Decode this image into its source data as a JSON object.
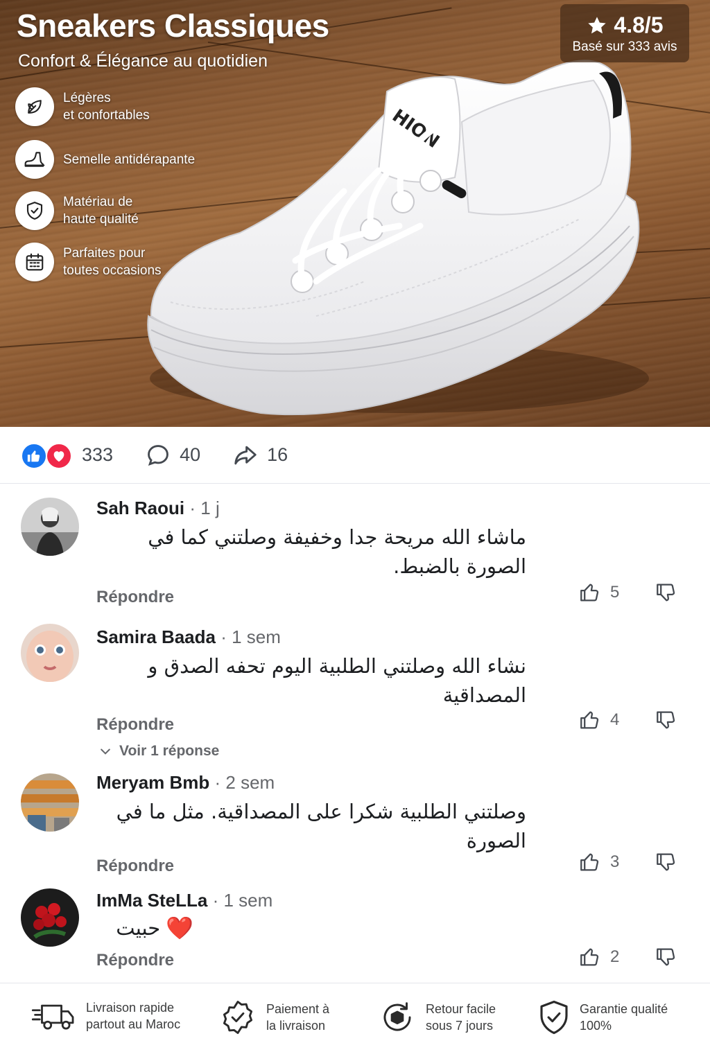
{
  "hero": {
    "title": "Sneakers Classiques",
    "subtitle": "Confort & Élégance au quotidien",
    "rating": {
      "value": "4.8/5",
      "caption": "Basé sur 333 avis"
    },
    "shoe_brand_text": "HION",
    "features": [
      {
        "icon": "leaf-icon",
        "text": "Légères\net confortables"
      },
      {
        "icon": "sole-icon",
        "text": "Semelle antidérapante"
      },
      {
        "icon": "shield-check-icon",
        "text": "Matériau de\nhaute qualité"
      },
      {
        "icon": "calendar-icon",
        "text": "Parfaites pour\ntoutes occasions"
      }
    ]
  },
  "reactions": {
    "total": "333",
    "comments": "40",
    "shares": "16"
  },
  "comments": [
    {
      "name": "Sah Raoui",
      "time": "· 1 j",
      "text": "ماشاء الله مريحة جدا وخفيفة وصلتني كما في الصورة بالضبط.",
      "reply": "Répondre",
      "likes": "5"
    },
    {
      "name": "Samira Baada",
      "time": "· 1 sem",
      "text": "نشاء الله وصلتني الطلبية اليوم تحفه الصدق و المصداقية",
      "reply": "Répondre",
      "likes": "4",
      "view_replies": "Voir 1 réponse"
    },
    {
      "name": "Meryam Bmb",
      "time": "· 2 sem",
      "text": "وصلتني الطلبية شكرا على المصداقية. مثل ما في الصورة",
      "reply": "Répondre",
      "likes": "3"
    },
    {
      "name": "ImMa SteLLa",
      "time": "· 1 sem",
      "text": "حبيت",
      "emoji": "❤️",
      "reply": "Répondre",
      "likes": "2"
    }
  ],
  "footer": [
    {
      "icon": "truck-icon",
      "text": "Livraison rapide\npartout au Maroc"
    },
    {
      "icon": "badge-check-icon",
      "text": "Paiement à\nla livraison"
    },
    {
      "icon": "return-box-icon",
      "text": "Retour facile\nsous 7 jours"
    },
    {
      "icon": "shield-quality-icon",
      "text": "Garantie qualité\n100%"
    }
  ],
  "colors": {
    "like_blue": "#1877f2",
    "love_red": "#f02849",
    "secondary_text": "#65676b"
  }
}
